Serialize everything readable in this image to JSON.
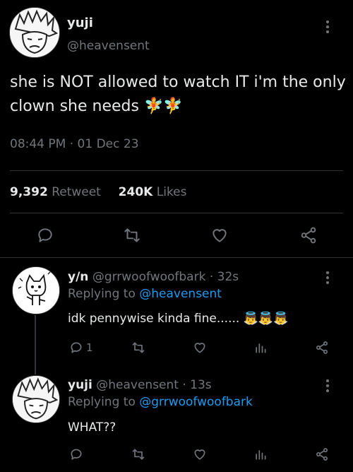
{
  "tweet": {
    "author_name": "yuji",
    "author_handle": "@heavensent",
    "text": "she is NOT allowed to watch IT i'm the only clown she needs",
    "emoji": "🧚🧚",
    "time": "08:44 PM",
    "separator": "·",
    "date": "01 Dec 23",
    "retweet_count": "9,392",
    "retweet_label": "Retweet",
    "like_count": "240K",
    "like_label": "Likes"
  },
  "replies": [
    {
      "name": "y/n",
      "handle": "@grrwoofwoofbark",
      "age": "· 32s",
      "replying_label": "Replying to",
      "replying_to": "@heavensent",
      "text": "idk pennywise kinda fine......",
      "emoji": "👼👼👼",
      "reply_count": "1"
    },
    {
      "name": "yuji",
      "handle": "@heavensent",
      "age": "· 13s",
      "replying_label": "Replying to",
      "replying_to": "@grrwoofwoofbark",
      "text": "WHAT??"
    }
  ],
  "icons": [
    "reply-icon",
    "retweet-icon",
    "like-icon",
    "share-icon",
    "analytics-icon",
    "more-icon"
  ]
}
